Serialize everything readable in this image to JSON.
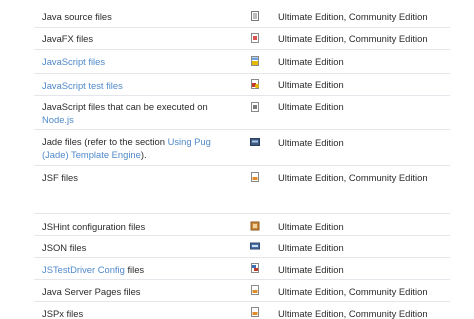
{
  "rows": [
    {
      "name": "Java source files",
      "link": false,
      "icon": "java-file-icon",
      "edition": "Ultimate Edition, Community Edition"
    },
    {
      "name": "JavaFX files",
      "link": false,
      "icon": "javafx-file-icon",
      "edition": "Ultimate Edition, Community Edition"
    },
    {
      "name": "JavaScript files",
      "link": true,
      "icon": "javascript-file-icon",
      "edition": "Ultimate Edition"
    },
    {
      "name": "JavaScript test files",
      "link": true,
      "icon": "javascript-test-file-icon",
      "edition": "Ultimate Edition"
    },
    {
      "name_part1": "JavaScript files that can be executed on",
      "name_part2": "Node.js",
      "icon": "nodejs-file-icon",
      "edition": "Ultimate Edition"
    },
    {
      "name_part1": "Jade files (refer to the section ",
      "name_link": "Using Pug (Jade) Template Engine",
      "name_part2": ").",
      "icon": "jade-file-icon",
      "edition": "Ultimate Edition"
    },
    {
      "name": "JSF files",
      "link": false,
      "icon": "jsf-file-icon",
      "edition": "Ultimate Edition, Community Edition"
    },
    {
      "name": "JSHint configuration files",
      "link": false,
      "icon": "jshint-config-icon",
      "edition": "Ultimate Edition"
    },
    {
      "name": "JSON files",
      "link": false,
      "icon": "json-file-icon",
      "edition": "Ultimate Edition"
    },
    {
      "name_link": "JSTestDriver Config",
      "name_part2": " files",
      "icon": "jstestdriver-config-icon",
      "edition": "Ultimate Edition"
    },
    {
      "name": "Java Server Pages files",
      "link": false,
      "icon": "jsp-file-icon",
      "edition": "Ultimate Edition, Community Edition"
    },
    {
      "name": "JSPx files",
      "link": false,
      "icon": "jspx-file-icon",
      "edition": "Ultimate Edition, Community Edition"
    }
  ],
  "colors": {
    "text": "#2b2b2b",
    "link": "#4f89c9",
    "divider": "#e3e6ea"
  }
}
